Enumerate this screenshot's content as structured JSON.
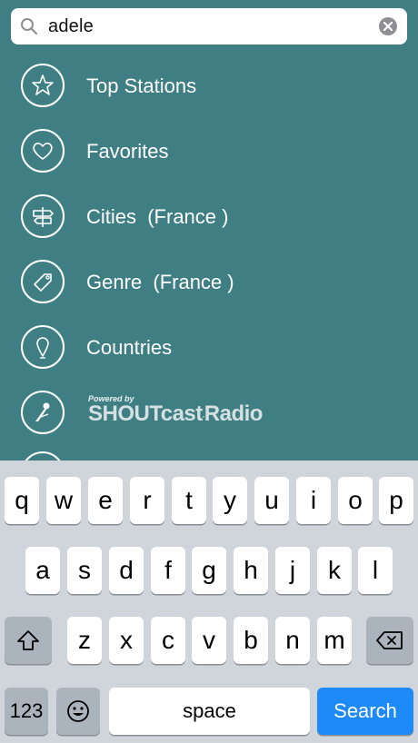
{
  "search": {
    "value": "adele",
    "icons": {
      "search": "magnifier-icon",
      "clear": "clear-x-icon"
    }
  },
  "menu": {
    "items": [
      {
        "label": "Top Stations",
        "icon": "star-icon"
      },
      {
        "label": "Favorites",
        "icon": "heart-icon"
      },
      {
        "label": "Cities  (France )",
        "icon": "signpost-icon"
      },
      {
        "label": "Genre  (France )",
        "icon": "tag-icon"
      },
      {
        "label": "Countries",
        "icon": "map-pin-icon"
      }
    ],
    "shoutcast": {
      "powered_by": "Powered by",
      "brand": "SHOUTcast",
      "brand_suffix": "Radio",
      "icon": "microphone-icon"
    }
  },
  "keyboard": {
    "row1": [
      "q",
      "w",
      "e",
      "r",
      "t",
      "y",
      "u",
      "i",
      "o",
      "p"
    ],
    "row2": [
      "a",
      "s",
      "d",
      "f",
      "g",
      "h",
      "j",
      "k",
      "l"
    ],
    "row3": [
      "z",
      "x",
      "c",
      "v",
      "b",
      "n",
      "m"
    ],
    "numbers_label": "123",
    "space_label": "space",
    "search_label": "Search",
    "icons": {
      "shift": "shift-icon",
      "delete": "backspace-icon",
      "emoji": "emoji-icon"
    }
  },
  "colors": {
    "background": "#3f7f84",
    "keyboard_bg": "#cfd5db",
    "key": "#ffffff",
    "key_special": "#abb3bc",
    "search_key": "#1e8af8"
  }
}
